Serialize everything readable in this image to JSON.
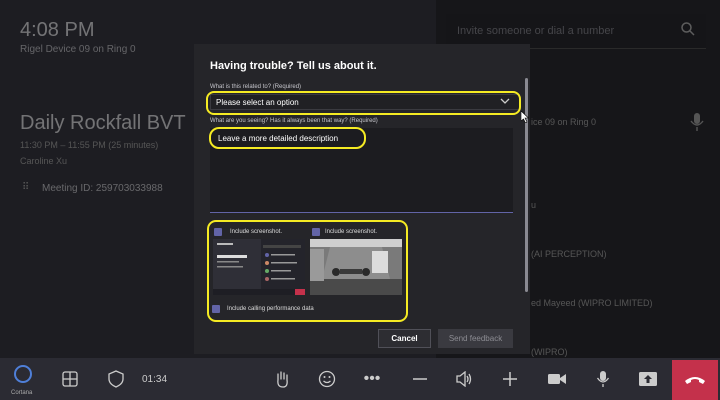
{
  "call": {
    "time": "4:08 PM",
    "device": "Rigel Device 09 on Ring 0",
    "meeting_title": "Daily Rockfall BVT",
    "meeting_time": "11:30 PM – 11:55 PM (25 minutes)",
    "organizer": "Caroline Xu",
    "meeting_id": "Meeting ID: 259703033988"
  },
  "right_panel": {
    "invite_placeholder": "Invite someone or dial a number",
    "fragments": [
      "ice 09 on Ring 0",
      "u",
      "(AI PERCEPTION)",
      "ed Mayeed (WIPRO LIMITED)",
      "(WIPRO)"
    ]
  },
  "dialog": {
    "title": "Having trouble? Tell us about it.",
    "related_label": "What is this related to? (Required)",
    "related_value": "Please select an option",
    "description_label": "What are you seeing? Has it always been that way? (Required)",
    "description_placeholder": "Leave a more detailed description",
    "screenshot_1_label": "Include screenshot.",
    "screenshot_2_label": "Include screenshot.",
    "perf_label": "Include calling performance data",
    "cancel_label": "Cancel",
    "send_label": "Send feedback"
  },
  "taskbar": {
    "cortana_label": "Cortana",
    "call_duration": "01:34"
  },
  "colors": {
    "accent": "#6264a7",
    "highlight": "#f5eb23",
    "hangup": "#c4314b"
  }
}
